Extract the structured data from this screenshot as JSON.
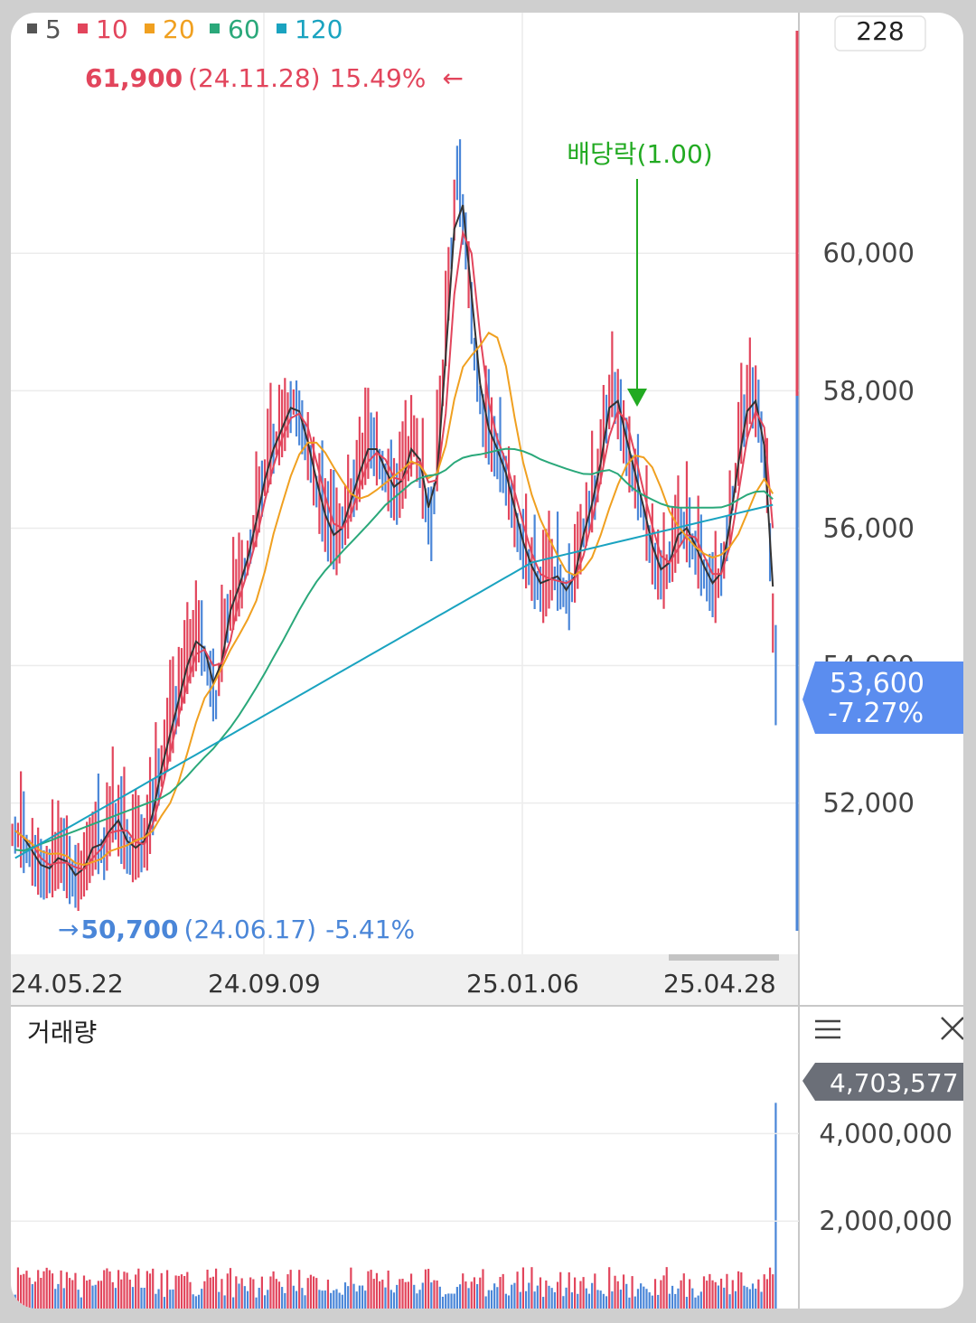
{
  "colors": {
    "up": "#e2455c",
    "down": "#4a86d8",
    "ma5": "#333333",
    "ma10": "#e2455c",
    "ma20": "#f0a020",
    "ma60": "#2aa87a",
    "ma120": "#1aa3c0",
    "annotation": "#22aa22",
    "price_tag": "#5b8def",
    "volume_tag": "#6b6f78"
  },
  "legend": [
    {
      "label": "5",
      "color_key": "ma5"
    },
    {
      "label": "10",
      "color_key": "ma10"
    },
    {
      "label": "20",
      "color_key": "ma20"
    },
    {
      "label": "60",
      "color_key": "ma60"
    },
    {
      "label": "120",
      "color_key": "ma120"
    }
  ],
  "count_box": "228",
  "high_marker": {
    "price": "61,900",
    "date": "(24.11.28)",
    "pct": "15.49%",
    "arrow": "←"
  },
  "low_marker": {
    "arrow": "→",
    "price": "50,700",
    "date": "(24.06.17)",
    "pct": "-5.41%"
  },
  "dividend": {
    "label": "배당락(1.00)"
  },
  "current_price": {
    "price": "53,600",
    "change": "-7.27%"
  },
  "volume_panel": {
    "title": "거래량",
    "tag": "4,703,577",
    "menu_icon": "menu-icon",
    "close_icon": "close-icon"
  },
  "chart_data": [
    {
      "type": "candlestick",
      "ylim": [
        49800,
        63500
      ],
      "yticks": [
        52000,
        56000,
        58000,
        60000
      ],
      "yticks_partial": [
        54000
      ],
      "xtick_labels": [
        "24.05.22",
        "24.09.09",
        "25.01.06",
        "25.04.28"
      ],
      "moving_averages": [
        "5",
        "10",
        "20",
        "60",
        "120"
      ],
      "approx_close": [
        51600,
        51400,
        51200,
        51000,
        51100,
        51300,
        51000,
        50900,
        51200,
        51500,
        51300,
        51900,
        51600,
        51300,
        51400,
        51500,
        52200,
        52800,
        53200,
        53800,
        54200,
        54500,
        54000,
        53500,
        54600,
        55000,
        55300,
        55800,
        56400,
        57000,
        57300,
        57600,
        57900,
        57500,
        57000,
        56400,
        56000,
        55800,
        56200,
        56600,
        57000,
        57300,
        57000,
        56700,
        56500,
        56900,
        57400,
        56600,
        56000,
        57500,
        59500,
        61200,
        60200,
        58600,
        57600,
        57300,
        57000,
        56600,
        56000,
        55600,
        55300,
        55100,
        55400,
        55200,
        55000,
        55600,
        56200,
        56500,
        57400,
        58100,
        57600,
        57000,
        56600,
        56000,
        55500,
        55300,
        55700,
        56100,
        55900,
        55600,
        55300,
        55100,
        55600,
        56500,
        57400,
        58000,
        57700,
        56700,
        53600
      ]
    },
    {
      "type": "bar",
      "name": "거래량",
      "yticks": [
        2000000,
        4000000
      ],
      "last_value": 4703577
    }
  ]
}
